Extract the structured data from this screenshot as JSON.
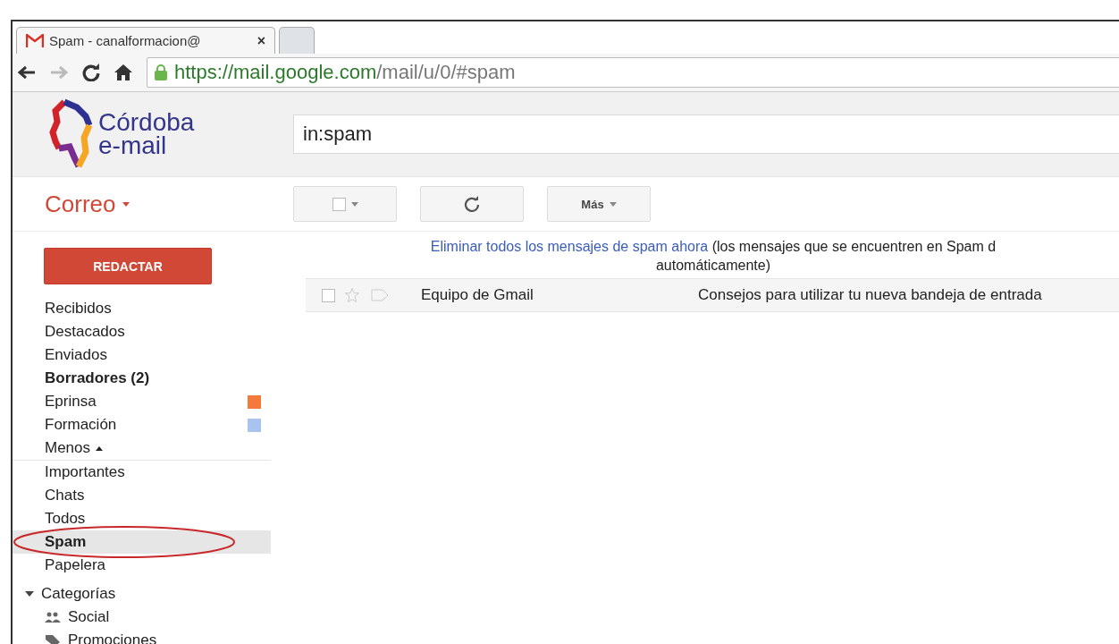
{
  "browser": {
    "tabs": [
      {
        "title": "Spam - canalformacion@",
        "selected": true,
        "close": "×"
      },
      {
        "selected": false
      }
    ],
    "url": {
      "host": "https://mail.google.com",
      "path": "/mail/u/0/#spam"
    }
  },
  "header": {
    "logo_lines": [
      "Córdoba",
      "e-mail"
    ],
    "search": {
      "value": "in:spam"
    }
  },
  "app_switcher": {
    "label": "Correo"
  },
  "toolbar": {
    "buttons": [
      {
        "kind": "select"
      },
      {
        "kind": "refresh"
      },
      {
        "kind": "more",
        "label": "Más"
      }
    ]
  },
  "compose": {
    "label": "REDACTAR"
  },
  "notice": {
    "link": "Eliminar todos los mensajes de spam ahora",
    "text": "(los mensajes que se encuentren en Spam d",
    "text_line2": "automáticamente)"
  },
  "messages": [
    {
      "sender": "Equipo de Gmail",
      "subject": "Consejos para utilizar tu nueva bandeja de entrada",
      "checked": false,
      "starred": false
    }
  ],
  "sidebar": {
    "items": [
      {
        "label": "Recibidos",
        "selected": false,
        "bold": false
      },
      {
        "label": "Destacados",
        "selected": false,
        "bold": false
      },
      {
        "label": "Enviados",
        "selected": false,
        "bold": false
      },
      {
        "label": "Borradores (2)",
        "selected": false,
        "bold": true
      },
      {
        "label": "Eprinsa",
        "selected": false,
        "bold": false,
        "color": "#f4793b"
      },
      {
        "label": "Formación",
        "selected": false,
        "bold": false,
        "color": "#a8c4ee"
      },
      {
        "label": "Menos",
        "selected": false,
        "bold": false,
        "kind": "toggle",
        "divider_after": true
      },
      {
        "label": "Importantes",
        "selected": false,
        "bold": false
      },
      {
        "label": "Chats",
        "selected": false,
        "bold": false
      },
      {
        "label": "Todos",
        "selected": false,
        "bold": false
      },
      {
        "label": "Spam",
        "selected": true,
        "bold": true,
        "circled": true
      },
      {
        "label": "Papelera",
        "selected": false,
        "bold": false
      }
    ],
    "categories": {
      "label": "Categorías",
      "expanded": true,
      "children": [
        {
          "label": "Social",
          "kind": "social"
        },
        {
          "label": "Promociones",
          "kind": "promo"
        }
      ]
    }
  }
}
